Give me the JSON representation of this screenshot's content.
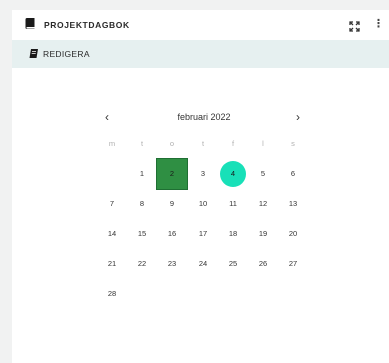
{
  "window": {
    "title": "PROJEKTDAGBOK"
  },
  "toolbar": {
    "edit_label": "REDIGERA"
  },
  "calendar": {
    "month_label": "februari 2022",
    "prev_label": "‹",
    "next_label": "›",
    "weekdays": [
      "m",
      "t",
      "o",
      "t",
      "f",
      "l",
      "s"
    ],
    "weeks": [
      [
        "",
        "1",
        "2",
        "3",
        "4",
        "5",
        "6"
      ],
      [
        "7",
        "8",
        "9",
        "10",
        "11",
        "12",
        "13"
      ],
      [
        "14",
        "15",
        "16",
        "17",
        "18",
        "19",
        "20"
      ],
      [
        "21",
        "22",
        "23",
        "24",
        "25",
        "26",
        "27"
      ],
      [
        "28",
        "",
        "",
        "",
        "",
        "",
        ""
      ]
    ],
    "today_day": "2",
    "selected_day": "4"
  },
  "colors": {
    "today": "#2f8f43",
    "selected": "#18e0b8",
    "toolbar_bg": "#e6f0f0"
  },
  "icons": {
    "title_icon": "book-icon",
    "edit_icon": "pencil-icon",
    "expand_icon": "fullscreen-icon",
    "menu_icon": "more-vertical-icon"
  }
}
